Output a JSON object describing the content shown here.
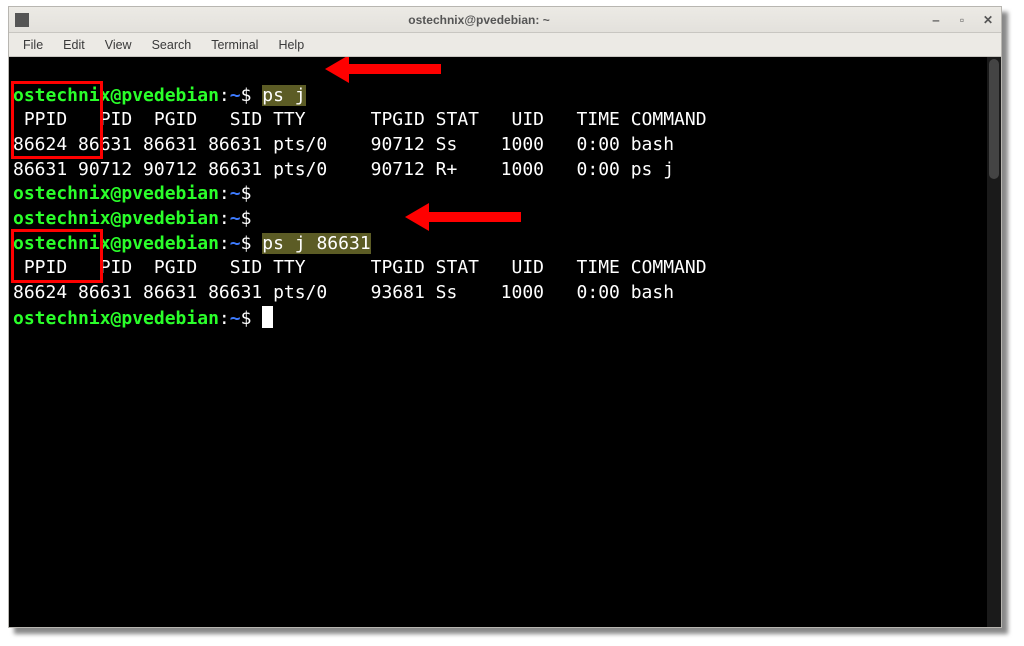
{
  "window": {
    "title": "ostechnix@pvedebian: ~",
    "buttons": {
      "min": "‒",
      "max": "▫",
      "close": "✕"
    }
  },
  "menu": {
    "file": "File",
    "edit": "Edit",
    "view": "View",
    "search": "Search",
    "terminal": "Terminal",
    "help": "Help"
  },
  "prompt": {
    "user": "ostechnix@pvedebian",
    "sep": ":",
    "path": "~",
    "dollar": "$"
  },
  "commands": {
    "ps_j": "ps j",
    "ps_j_pid": "ps j 86631"
  },
  "headers": {
    "line": " PPID   PID  PGID   SID TTY      TPGID STAT   UID   TIME COMMAND"
  },
  "block1": {
    "row1": "86624 86631 86631 86631 pts/0    90712 Ss    1000   0:00 bash",
    "row2": "86631 90712 90712 86631 pts/0    90712 R+    1000   0:00 ps j"
  },
  "block2": {
    "row1": "86624 86631 86631 86631 pts/0    93681 Ss    1000   0:00 bash"
  },
  "chart_data": {
    "type": "table",
    "title": "Output of `ps j` showing parent/child PIDs",
    "columns": [
      "PPID",
      "PID",
      "PGID",
      "SID",
      "TTY",
      "TPGID",
      "STAT",
      "UID",
      "TIME",
      "COMMAND"
    ],
    "tables": [
      {
        "command": "ps j",
        "rows": [
          [
            86624,
            86631,
            86631,
            86631,
            "pts/0",
            90712,
            "Ss",
            1000,
            "0:00",
            "bash"
          ],
          [
            86631,
            90712,
            90712,
            86631,
            "pts/0",
            90712,
            "R+",
            1000,
            "0:00",
            "ps j"
          ]
        ]
      },
      {
        "command": "ps j 86631",
        "rows": [
          [
            86624,
            86631,
            86631,
            86631,
            "pts/0",
            93681,
            "Ss",
            1000,
            "0:00",
            "bash"
          ]
        ]
      }
    ]
  }
}
